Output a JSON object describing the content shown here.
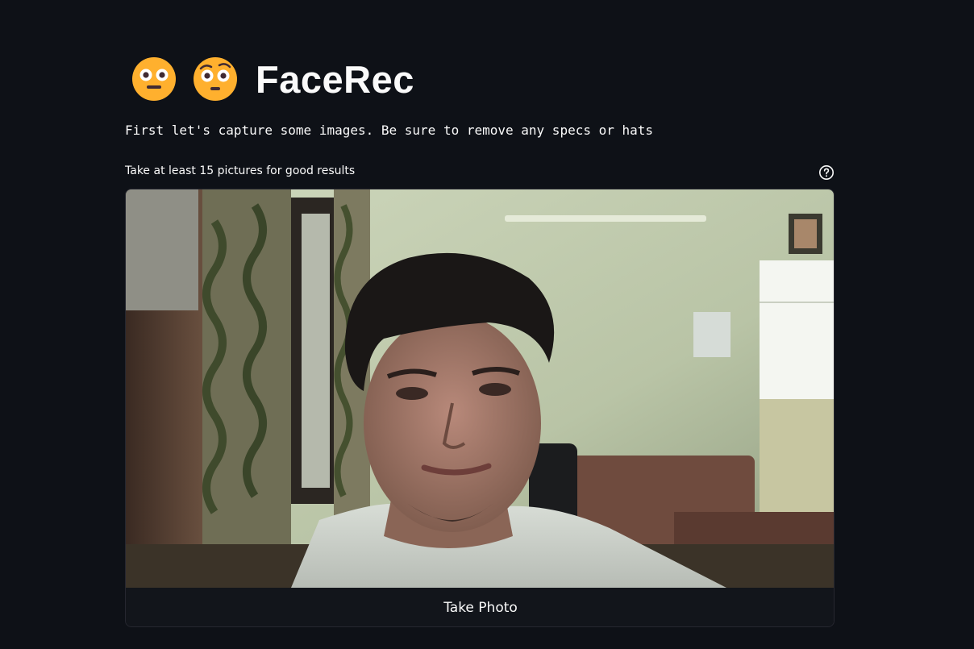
{
  "header": {
    "emojis": [
      "neutral-face-flushed-icon",
      "raised-eyebrow-flushed-icon"
    ],
    "title": "FaceRec"
  },
  "intro": {
    "text": "First let's capture some images. Be sure to remove any specs or hats"
  },
  "camera": {
    "label": "Take at least 15 pictures for good results",
    "help_icon": "help-circle-icon",
    "button_label": "Take Photo"
  },
  "colors": {
    "background": "#0e1117",
    "text": "#fafafa",
    "card_border": "#262730",
    "emoji_yellow": "#ffb02e"
  }
}
